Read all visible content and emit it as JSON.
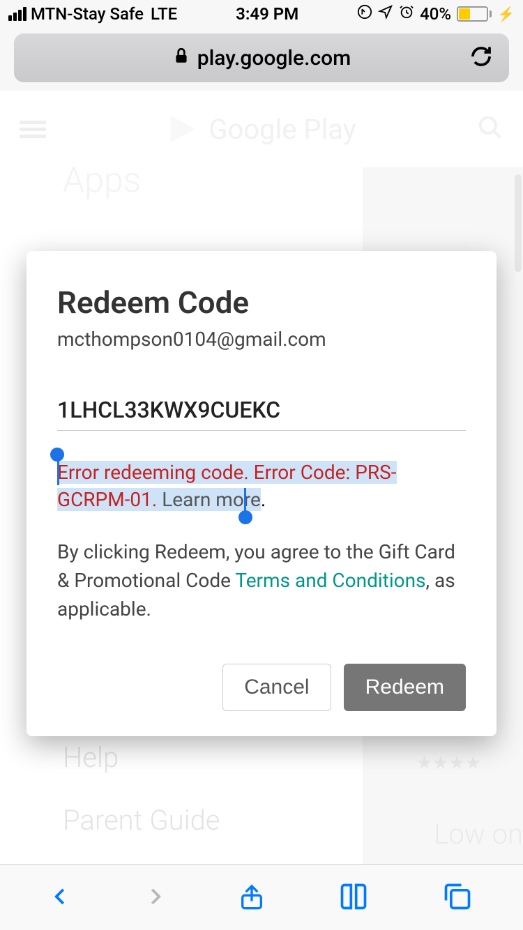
{
  "status_bar": {
    "carrier": "MTN-Stay Safe",
    "network": "LTE",
    "time": "3:49 PM",
    "battery_pct": "40%"
  },
  "address_bar": {
    "domain": "play.google.com"
  },
  "play_header": {
    "title": "Google Play"
  },
  "background": {
    "apps_label": "Apps",
    "help_label": "Help",
    "parent_guide_label": "Parent Guide",
    "low_on_label": "Low on"
  },
  "modal": {
    "title": "Redeem Code",
    "email": "mcthompson0104@gmail.com",
    "code_value": "1LHCL33KWX9CUEKC",
    "error_message": "Error redeeming code. Error Code: PRS-GCRPM-01.",
    "learn_more_label": "Learn more",
    "agree_prefix": "By clicking Redeem, you agree to the Gift Card & Promotional Code ",
    "terms_label": "Terms and Conditions",
    "agree_suffix": ", as applicable.",
    "cancel_label": "Cancel",
    "redeem_label": "Redeem"
  }
}
